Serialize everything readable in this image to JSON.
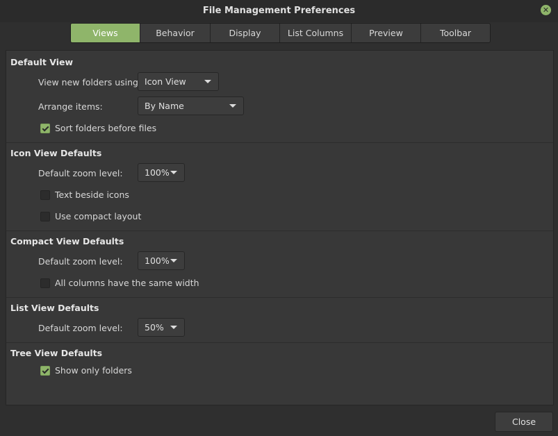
{
  "window": {
    "title": "File Management Preferences"
  },
  "tabs": [
    "Views",
    "Behavior",
    "Display",
    "List Columns",
    "Preview",
    "Toolbar"
  ],
  "default_view": {
    "title": "Default View",
    "view_label": "View new folders using:",
    "view_value": "Icon View",
    "arrange_label": "Arrange items:",
    "arrange_value": "By Name",
    "sort_folders_label": "Sort folders before files",
    "sort_folders_checked": true
  },
  "icon_view": {
    "title": "Icon View Defaults",
    "zoom_label": "Default zoom level:",
    "zoom_value": "100%",
    "text_beside_label": "Text beside icons",
    "text_beside_checked": false,
    "compact_label": "Use compact layout",
    "compact_checked": false
  },
  "compact_view": {
    "title": "Compact View Defaults",
    "zoom_label": "Default zoom level:",
    "zoom_value": "100%",
    "same_width_label": "All columns have the same width",
    "same_width_checked": false
  },
  "list_view": {
    "title": "List View Defaults",
    "zoom_label": "Default zoom level:",
    "zoom_value": "50%"
  },
  "tree_view": {
    "title": "Tree View Defaults",
    "folders_only_label": "Show only folders",
    "folders_only_checked": true
  },
  "footer": {
    "close_label": "Close"
  },
  "colors": {
    "accent": "#8fb56a",
    "background": "#2f2f2f",
    "panel": "#383838"
  }
}
